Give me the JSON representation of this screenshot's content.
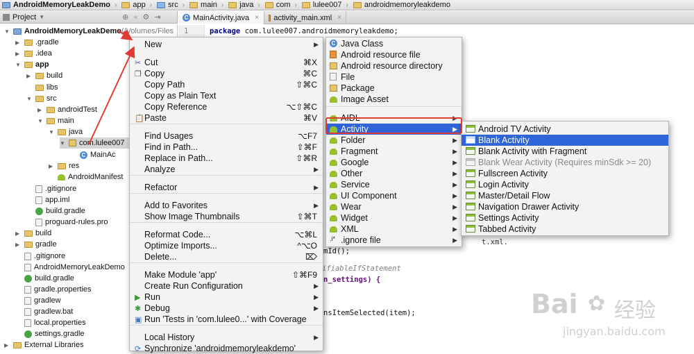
{
  "breadcrumb": [
    "AndroidMemoryLeakDemo",
    "app",
    "src",
    "main",
    "java",
    "com",
    "lulee007",
    "androidmemoryleakdemo"
  ],
  "project_panel": {
    "title": "Project",
    "tree": [
      {
        "label": "AndroidMemoryLeakDemo",
        "suffix": " (/Volumes/Files",
        "bold": true,
        "indent": 0,
        "expanded": true,
        "icon": "module-icon"
      },
      {
        "label": ".gradle",
        "indent": 1,
        "expanded": false,
        "icon": "folder-icon"
      },
      {
        "label": ".idea",
        "indent": 1,
        "expanded": false,
        "icon": "folder-icon"
      },
      {
        "label": "app",
        "bold": true,
        "indent": 1,
        "expanded": true,
        "icon": "folder-icon"
      },
      {
        "label": "build",
        "indent": 2,
        "expanded": false,
        "icon": "folder-icon"
      },
      {
        "label": "libs",
        "indent": 2,
        "icon": "folder-icon"
      },
      {
        "label": "src",
        "indent": 2,
        "expanded": true,
        "icon": "folder-icon"
      },
      {
        "label": "androidTest",
        "indent": 3,
        "expanded": false,
        "icon": "folder-icon"
      },
      {
        "label": "main",
        "indent": 3,
        "expanded": true,
        "icon": "folder-icon"
      },
      {
        "label": "java",
        "indent": 4,
        "expanded": true,
        "icon": "folder-icon"
      },
      {
        "label": "com.lulee007",
        "indent": 5,
        "expanded": true,
        "icon": "package-icon"
      },
      {
        "label": "MainAc",
        "indent": 6,
        "icon": "class-icon"
      },
      {
        "label": "res",
        "indent": 4,
        "expanded": false,
        "icon": "folder-icon"
      },
      {
        "label": "AndroidManifest",
        "indent": 4,
        "icon": "android-icon"
      },
      {
        "label": ".gitignore",
        "indent": 2,
        "icon": "file-icon"
      },
      {
        "label": "app.iml",
        "indent": 2,
        "icon": "file-icon"
      },
      {
        "label": "build.gradle",
        "indent": 2,
        "icon": "gradle-icon"
      },
      {
        "label": "proguard-rules.pro",
        "indent": 2,
        "icon": "file-icon"
      },
      {
        "label": "build",
        "indent": 1,
        "expanded": false,
        "icon": "folder-icon"
      },
      {
        "label": "gradle",
        "indent": 1,
        "expanded": false,
        "icon": "folder-icon"
      },
      {
        "label": ".gitignore",
        "indent": 1,
        "icon": "file-icon"
      },
      {
        "label": "AndroidMemoryLeakDemo",
        "indent": 1,
        "icon": "file-icon"
      },
      {
        "label": "build.gradle",
        "indent": 1,
        "icon": "gradle-icon"
      },
      {
        "label": "gradle.properties",
        "indent": 1,
        "icon": "file-icon"
      },
      {
        "label": "gradlew",
        "indent": 1,
        "icon": "file-icon"
      },
      {
        "label": "gradlew.bat",
        "indent": 1,
        "icon": "file-icon"
      },
      {
        "label": "local.properties",
        "indent": 1,
        "icon": "file-icon"
      },
      {
        "label": "settings.gradle",
        "indent": 1,
        "icon": "gradle-icon"
      },
      {
        "label": "External Libraries",
        "indent": 0,
        "expanded": false,
        "icon": "library-icon"
      }
    ]
  },
  "editor": {
    "tabs": [
      {
        "label": "MainActivity.java",
        "active": true
      },
      {
        "label": "activity_main.xml",
        "active": false
      }
    ],
    "line_number": "1",
    "code": {
      "package_kw": "package",
      "package_name": " com.lulee007.androidmemoryleakdemo;",
      "frag1": "t.xml.",
      "frag2": "mId();",
      "frag3": "ifiableIfStatement",
      "frag4": "n_settings) {",
      "frag5": "nsItemSelected(item);"
    }
  },
  "context_menu": {
    "items": [
      {
        "label": "New",
        "submenu": true
      },
      {
        "label": "Cut",
        "shortcut": "⌘X",
        "icon": "scissors-icon"
      },
      {
        "label": "Copy",
        "shortcut": "⌘C",
        "icon": "copy-icon"
      },
      {
        "label": "Copy Path",
        "shortcut": "⇧⌘C"
      },
      {
        "label": "Copy as Plain Text",
        "shortcut": ""
      },
      {
        "label": "Copy Reference",
        "shortcut": "⌥⇧⌘C"
      },
      {
        "label": "Paste",
        "shortcut": "⌘V",
        "icon": "paste-icon"
      },
      {
        "label": "Find Usages",
        "shortcut": "⌥F7"
      },
      {
        "label": "Find in Path...",
        "shortcut": "⇧⌘F"
      },
      {
        "label": "Replace in Path...",
        "shortcut": "⇧⌘R"
      },
      {
        "label": "Analyze",
        "submenu": true
      },
      {
        "label": "Refactor",
        "submenu": true
      },
      {
        "label": "Add to Favorites",
        "submenu": true
      },
      {
        "label": "Show Image Thumbnails",
        "shortcut": "⇧⌘T"
      },
      {
        "label": "Reformat Code...",
        "shortcut": "⌥⌘L"
      },
      {
        "label": "Optimize Imports...",
        "shortcut": "^⌥O"
      },
      {
        "label": "Delete...",
        "shortcut": "⌦"
      },
      {
        "label": "Make Module 'app'",
        "shortcut": "⇧⌘F9"
      },
      {
        "label": "Create Run Configuration",
        "submenu": true
      },
      {
        "label": "Run",
        "submenu": true,
        "icon": "run-icon"
      },
      {
        "label": "Debug",
        "submenu": true,
        "icon": "debug-icon"
      },
      {
        "label": "Run 'Tests in 'com.lulee0...' with Coverage",
        "icon": "coverage-icon"
      },
      {
        "label": "Local History",
        "submenu": true
      },
      {
        "label": "Synchronize 'androidmemoryleakdemo'",
        "icon": "sync-icon"
      }
    ]
  },
  "new_submenu": {
    "items": [
      {
        "label": "Java Class",
        "icon": "class-icon"
      },
      {
        "label": "Android resource file",
        "icon": "resource-file-icon"
      },
      {
        "label": "Android resource directory",
        "icon": "folder-icon"
      },
      {
        "label": "File",
        "icon": "file-icon"
      },
      {
        "label": "Package",
        "icon": "package-icon"
      },
      {
        "label": "Image Asset",
        "icon": "android-icon"
      },
      {
        "label": "AIDL",
        "submenu": true,
        "icon": "android-icon"
      },
      {
        "label": "Activity",
        "submenu": true,
        "selected": true,
        "icon": "android-icon"
      },
      {
        "label": "Folder",
        "submenu": true,
        "icon": "android-icon"
      },
      {
        "label": "Fragment",
        "submenu": true,
        "icon": "android-icon"
      },
      {
        "label": "Google",
        "submenu": true,
        "icon": "android-icon"
      },
      {
        "label": "Other",
        "submenu": true,
        "icon": "android-icon"
      },
      {
        "label": "Service",
        "submenu": true,
        "icon": "android-icon"
      },
      {
        "label": "UI Component",
        "submenu": true,
        "icon": "android-icon"
      },
      {
        "label": "Wear",
        "submenu": true,
        "icon": "android-icon"
      },
      {
        "label": "Widget",
        "submenu": true,
        "icon": "android-icon"
      },
      {
        "label": "XML",
        "submenu": true,
        "icon": "android-icon"
      },
      {
        "label": ".ignore file",
        "submenu": true,
        "icon": "ignore-file-icon"
      }
    ]
  },
  "activity_submenu": {
    "items": [
      {
        "label": "Android TV Activity"
      },
      {
        "label": "Blank Activity",
        "selected": true
      },
      {
        "label": "Blank Activity with Fragment"
      },
      {
        "label": "Blank Wear Activity (Requires minSdk >= 20)",
        "disabled": true
      },
      {
        "label": "Fullscreen Activity"
      },
      {
        "label": "Login Activity"
      },
      {
        "label": "Master/Detail Flow"
      },
      {
        "label": "Navigation Drawer Activity"
      },
      {
        "label": "Settings Activity"
      },
      {
        "label": "Tabbed Activity"
      }
    ]
  },
  "watermark": {
    "logo": "Bai",
    "logo_cn": "经验",
    "url": "jingyan.baidu.com"
  },
  "colors": {
    "selection": "#2f65d8",
    "annotation": "#e23b35"
  }
}
